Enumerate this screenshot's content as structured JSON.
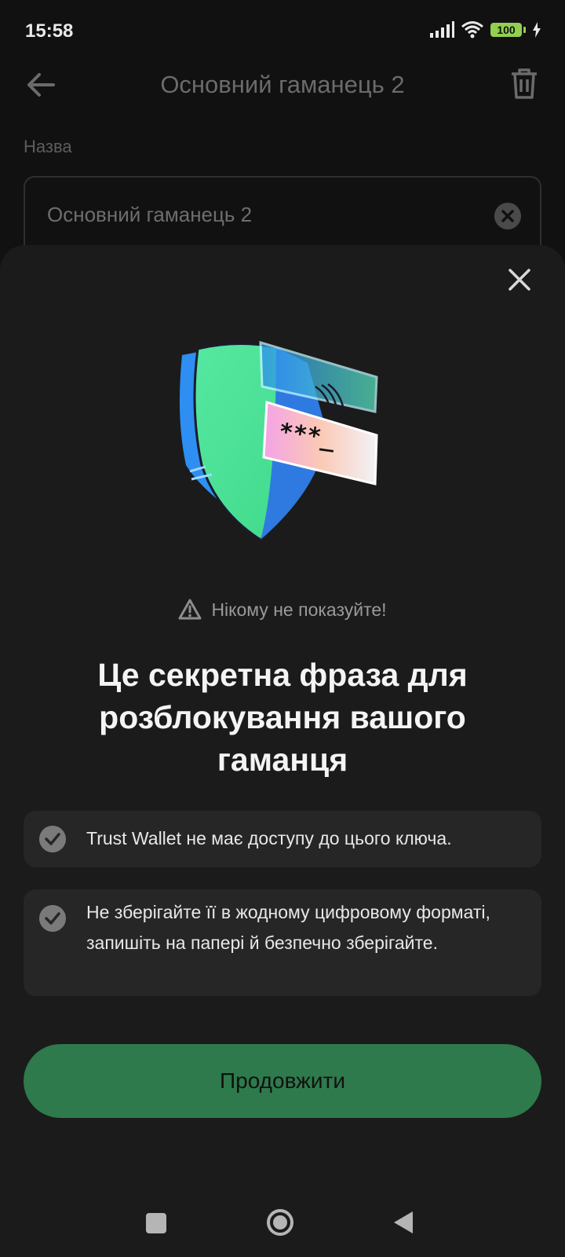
{
  "status_bar": {
    "time": "15:58",
    "battery": "100",
    "icons": [
      "signal-icon",
      "wifi-icon",
      "battery-icon",
      "charging-icon"
    ]
  },
  "top_bar": {
    "title": "Основний гаманець 2",
    "icons": [
      "back-arrow-icon",
      "trash-icon"
    ]
  },
  "name_section": {
    "label": "Назва",
    "value": "Основний гаманець 2"
  },
  "sheet": {
    "warning": "Нікому не показуйте!",
    "headline": "Це секретна фраза для розблокування вашого гаманця",
    "points": [
      "Trust Wallet не має доступу до цього ключа.",
      "Не зберігайте її в жодному цифровому форматі, запишіть на папері й безпечно зберігайте."
    ],
    "continue_label": "Продовжити",
    "illustration_password": "***_"
  },
  "colors": {
    "accent_green": "#2e7a4c",
    "sheet_bg": "#1b1b1b",
    "card_bg": "#262626"
  }
}
